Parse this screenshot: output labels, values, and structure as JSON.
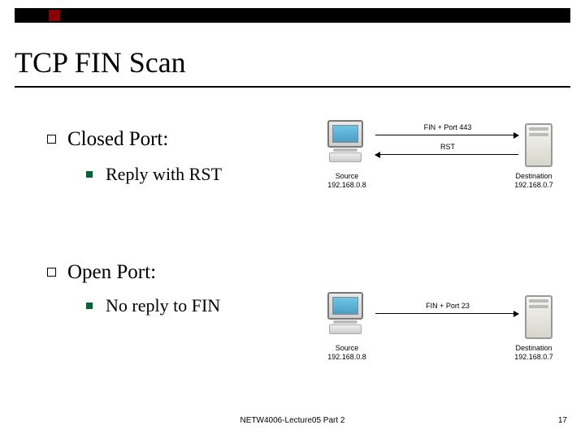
{
  "title": "TCP FIN Scan",
  "bullets": {
    "closed": {
      "label": "Closed Port:",
      "sub": "Reply with RST",
      "source_label": "Source",
      "source_ip": "192.168.0.8",
      "dest_label": "Destination",
      "dest_ip": "192.168.0.7",
      "arrow_top": "FIN + Port 443",
      "arrow_bottom": "RST"
    },
    "open": {
      "label": "Open Port:",
      "sub": "No reply to FIN",
      "source_label": "Source",
      "source_ip": "192.168.0.8",
      "dest_label": "Destination",
      "dest_ip": "192.168.0.7",
      "arrow_top": "FIN + Port 23"
    }
  },
  "footer": "NETW4006-Lecture05 Part 2",
  "page": "17"
}
